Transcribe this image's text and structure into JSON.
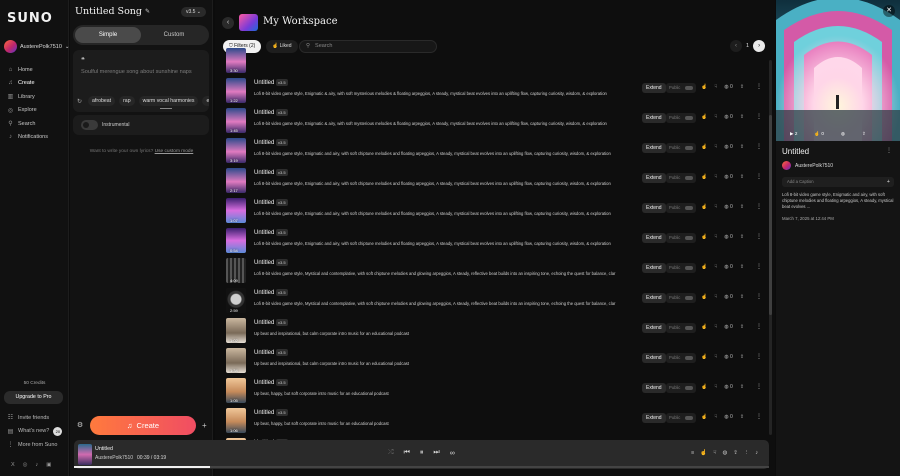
{
  "brand": "SUNO",
  "user": {
    "name": "AusterePolk7510"
  },
  "nav": {
    "items": [
      {
        "label": "Home",
        "icon": "home-icon",
        "glyph": "⌂",
        "active": false
      },
      {
        "label": "Create",
        "icon": "music-note-icon",
        "glyph": "♫",
        "active": true
      },
      {
        "label": "Library",
        "icon": "library-icon",
        "glyph": "▥",
        "active": false
      },
      {
        "label": "Explore",
        "icon": "compass-icon",
        "glyph": "◎",
        "active": false
      },
      {
        "label": "Search",
        "icon": "search-icon",
        "glyph": "⚲",
        "active": false
      },
      {
        "label": "Notifications",
        "icon": "bell-icon",
        "glyph": "♪",
        "active": false
      }
    ],
    "credits": "50 Credits",
    "upgrade_label": "Upgrade to Pro",
    "bottom": [
      {
        "label": "Invite friends",
        "icon": "invite-icon",
        "glyph": "☷"
      },
      {
        "label": "What's new?",
        "icon": "news-icon",
        "glyph": "▤",
        "badge": "20"
      },
      {
        "label": "More from Suno",
        "icon": "more-icon",
        "glyph": "⋮"
      }
    ],
    "social": [
      "X",
      "◎",
      "♪",
      "▣"
    ]
  },
  "create_panel": {
    "song_title": "Untitled Song",
    "version": "v3.5",
    "modes": [
      "Simple",
      "Custom"
    ],
    "active_mode": "Simple",
    "prompt_placeholder": "Soulful merengue song about sunshine naps",
    "tags": [
      "afrobeat",
      "rap",
      "warm vocal harmonies",
      "el"
    ],
    "instrumental_label": "Instrumental",
    "lyrics_hint": "Want to write your own lyrics?",
    "lyrics_link": "Use custom mode",
    "create_label": "Create"
  },
  "workspace": {
    "title": "My Workspace",
    "filters_label": "Filters (2)",
    "liked_label": "Liked",
    "search_placeholder": "Search",
    "page": "1",
    "extend_label": "Extend",
    "public_label": "Public",
    "top_partial_duration": "3:30",
    "rows": [
      {
        "title": "Untitled",
        "version": "v3.5",
        "duration": "1:22",
        "desc": "Lofi 8-bit video game style, Enigmatic & airy, with soft mysterious melodies & floating arpeggios, A steady, mystical beat evolves into an uplifting flow, capturing curiosity, wisdom, & exploration",
        "likes": "0",
        "comments": "0",
        "art": "a"
      },
      {
        "title": "Untitled",
        "version": "v3.5",
        "duration": "1:45",
        "desc": "Lofi 8-bit video game style, Enigmatic & airy, with soft mysterious melodies & floating arpeggios, A steady, mystical beat evolves into an uplifting flow, capturing curiosity, wisdom, & exploration",
        "likes": "0",
        "comments": "0",
        "art": "a"
      },
      {
        "title": "Untitled",
        "version": "v3.5",
        "duration": "3:19",
        "desc": "Lofi 8-bit video game style, Enigmatic and airy, with soft chiptune melodies and floating arpeggios, A steady, mystical beat evolves into an uplifting flow, capturing curiosity, wisdom, & exploration",
        "likes": "0",
        "comments": "0",
        "art": "a"
      },
      {
        "title": "Untitled",
        "version": "v3.5",
        "duration": "2:17",
        "desc": "Lofi 8-bit video game style, Enigmatic and airy, with soft chiptune melodies and floating arpeggios, A steady, mystical beat evolves into an uplifting flow, capturing curiosity, wisdom, & exploration",
        "likes": "0",
        "comments": "0",
        "art": "a"
      },
      {
        "title": "Untitled",
        "version": "v3.5",
        "duration": "1:07",
        "desc": "Lofi 8-bit video game style, Enigmatic and airy, with soft chiptune melodies and floating arpeggios, A steady, mystical beat evolves into an uplifting flow, capturing curiosity, wisdom, & exploration",
        "likes": "0",
        "comments": "0",
        "art": "b"
      },
      {
        "title": "Untitled",
        "version": "v3.5",
        "duration": "0:54",
        "desc": "Lofi 8-bit video game style, Enigmatic and airy, with soft chiptune melodies and floating arpeggios, A steady, mystical beat evolves into an uplifting flow, capturing curiosity, wisdom, & exploration",
        "likes": "0",
        "comments": "0",
        "art": "b"
      },
      {
        "title": "Untitled",
        "version": "v3.5",
        "duration": "4:09",
        "desc": "Lofi 8-bit video game style, Mystical and contemplative, with soft chiptune melodies and glowing arpeggios, A steady, reflective beat builds into an inspiring tone, echoing the quest for balance, clar",
        "likes": "0",
        "comments": "0",
        "art": "c"
      },
      {
        "title": "Untitled",
        "version": "v3.5",
        "duration": "2:59",
        "desc": "Lofi 8-bit video game style, Mystical and contemplative, with soft chiptune melodies and glowing arpeggios, A steady, reflective beat builds into an inspiring tone, echoing the quest for balance, clar",
        "likes": "0",
        "comments": "0",
        "art": "d"
      },
      {
        "title": "Untitled",
        "version": "v3.5",
        "duration": "1:02",
        "desc": "Up beat and inspirational, but calm corporate intro music for an educational podcast",
        "likes": "0",
        "comments": "0",
        "art": "e"
      },
      {
        "title": "Untitled",
        "version": "v3.5",
        "duration": "1:34",
        "desc": "Up beat and inspirational, but calm corporate intro music for an educational podcast",
        "likes": "0",
        "comments": "0",
        "art": "e"
      },
      {
        "title": "Untitled",
        "version": "v3.5",
        "duration": "1:05",
        "desc": "Up beat, happy, but soft corporate intro music for an educational podcast",
        "likes": "0",
        "comments": "0",
        "art": "f"
      },
      {
        "title": "Untitled",
        "version": "v3.5",
        "duration": "1:06",
        "desc": "Up beat, happy, but soft corporate intro music for an educational podcast",
        "likes": "0",
        "comments": "0",
        "art": "f"
      }
    ],
    "bottom_partial": {
      "title": "Untitled",
      "version": "v3.5"
    }
  },
  "player": {
    "title": "Untitled",
    "artist": "AusterePolk7510",
    "time": "00:39 / 03:19",
    "progress": 0.196
  },
  "detail": {
    "title": "Untitled",
    "user": "AusterePolk7510",
    "plays": "2",
    "likes": "0",
    "caption_placeholder": "Add a Caption",
    "description": "Lofi 8-bit video game style, Enigmatic and airy, with soft chiptune melodies and floating arpeggios, A steady, mystical beat evolves ...",
    "date": "March 7, 2025 at 12:44 PM"
  },
  "colors": {
    "accent_start": "#ff7a3d",
    "accent_end": "#f04d63",
    "background": "#0c0c0c"
  }
}
